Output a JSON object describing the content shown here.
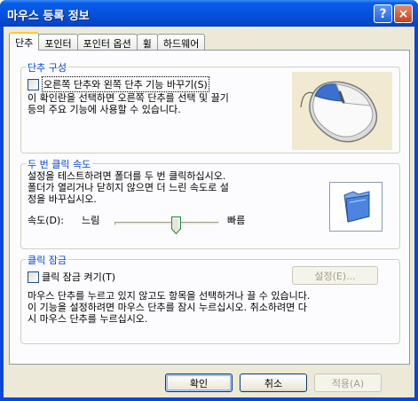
{
  "window": {
    "title": "마우스 등록 정보",
    "help_glyph": "?",
    "close_glyph": "×"
  },
  "tabs": [
    {
      "label": "단추",
      "active": true
    },
    {
      "label": "포인터",
      "active": false
    },
    {
      "label": "포인터 옵션",
      "active": false
    },
    {
      "label": "휠",
      "active": false
    },
    {
      "label": "하드웨어",
      "active": false
    }
  ],
  "button_config": {
    "title": "단추 구성",
    "checkbox_label": "오른쪽 단추와 왼쪽 단추 기능 바꾸기(S)",
    "checked": false,
    "description": [
      "이 확인란을 선택하면 오른쪽 단추를 선택 및 끌기",
      "등의 주요 기능에 사용할 수 있습니다."
    ]
  },
  "double_click": {
    "title": "두 번 클릭 속도",
    "description": [
      "설정을 테스트하려면 폴더를 두 번 클릭하십시오.",
      "폴더가 열리거나 닫히지 않으면 더 느린 속도로 설",
      "정을 바꾸십시오."
    ],
    "speed_label": "속도(D):",
    "slow_label": "느림",
    "fast_label": "빠름",
    "speed_value_fraction": 0.6
  },
  "click_lock": {
    "title": "클릭 잠금",
    "checkbox_label": "클릭 잠금 켜기(T)",
    "checked": false,
    "settings_button": "설정(E)...",
    "description": [
      "마우스 단추를 누르고 있지 않고도 항목을 선택하거나 끌 수 있습니다.",
      "이 기능을 설정하려면 마우스 단추를 잠시 누르십시오. 취소하려면 다",
      "시 마우스 단추를 누르십시오."
    ]
  },
  "footer": {
    "ok": "확인",
    "cancel": "취소",
    "apply": "적용(A)"
  },
  "colors": {
    "title_blue": "#0a5ce8",
    "group_title": "#0046d5",
    "dialog_bg": "#ece9d8",
    "close_red": "#c7411f"
  },
  "icons": [
    "help-icon",
    "close-icon",
    "mouse-illustration",
    "test-folder-icon",
    "slider-thumb-icon"
  ]
}
